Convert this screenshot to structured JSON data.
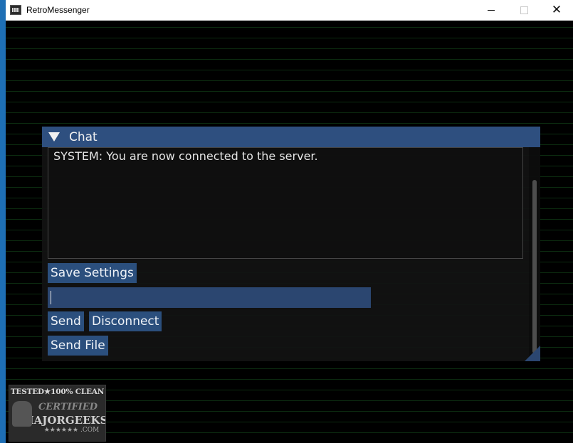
{
  "window": {
    "title": "RetroMessenger",
    "accent": "#1e6fb5"
  },
  "chat": {
    "header": "Chat",
    "messages": [
      "SYSTEM: You are now connected to the server."
    ],
    "input_value": "",
    "buttons": {
      "save_settings": "Save Settings",
      "send": "Send",
      "disconnect": "Disconnect",
      "send_file": "Send File"
    },
    "colors": {
      "header": "#2e4f7f",
      "button": "#2b4f7d"
    }
  },
  "badge": {
    "top": "TESTED★100% CLEAN",
    "certified": "CERTIFIED",
    "brand": "MAJORGEEKS",
    "domain": "★★★★★★ .COM"
  }
}
